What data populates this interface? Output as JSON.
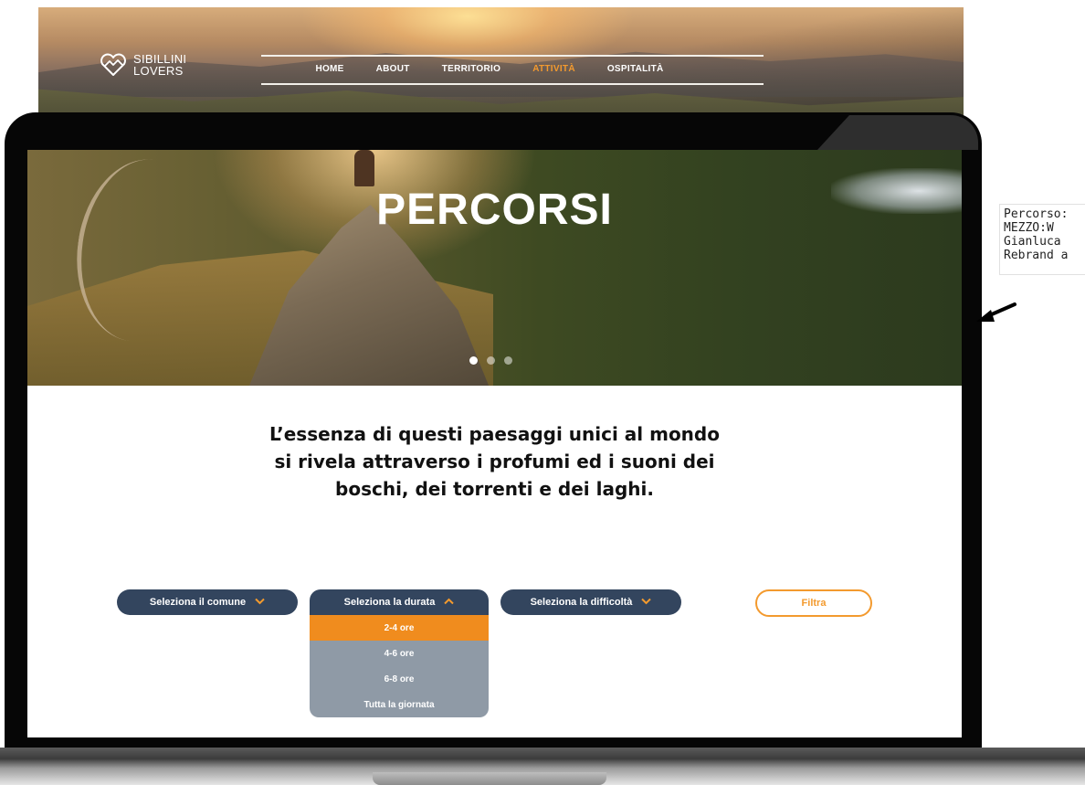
{
  "site": {
    "logo": {
      "line1": "SIBILLINI",
      "line2": "LOVERS",
      "icon": "heart-mountain-icon"
    },
    "nav": [
      {
        "label": "HOME",
        "active": false
      },
      {
        "label": "ABOUT",
        "active": false
      },
      {
        "label": "TERRITORIO",
        "active": false
      },
      {
        "label": "ATTIVITÀ",
        "active": true
      },
      {
        "label": "OSPITALITÀ",
        "active": false
      }
    ],
    "accent_color": "#f39a2e"
  },
  "hero": {
    "title": "PERCORSI",
    "slides": {
      "count": 3,
      "active_index": 0
    }
  },
  "tagline": {
    "lines": [
      "L’essenza di questi paesaggi unici al mondo",
      "si rivela attraverso i profumi ed i suoni dei",
      "boschi, dei torrenti e dei laghi."
    ]
  },
  "filters": {
    "comune": {
      "label": "Seleziona il comune",
      "icon": "chevron-down-icon"
    },
    "durata": {
      "label": "Seleziona la durata",
      "icon": "chevron-up-icon",
      "open": true,
      "options": [
        "2-4 ore",
        "4-6 ore",
        "6-8 ore",
        "Tutta la giornata"
      ],
      "selected_index": 0
    },
    "difficolta": {
      "label": "Seleziona la difficoltà",
      "icon": "chevron-down-icon"
    },
    "submit_label": "Filtra",
    "pill_color": "#33455e",
    "dropdown_color": "#8f9aa6",
    "selected_color": "#f08c1e"
  },
  "annotation": {
    "lines": [
      "Percorso:",
      "MEZZO:W",
      "Gianluca",
      "Rebrand a"
    ],
    "arrow_icon": "arrow-down-left-icon"
  }
}
